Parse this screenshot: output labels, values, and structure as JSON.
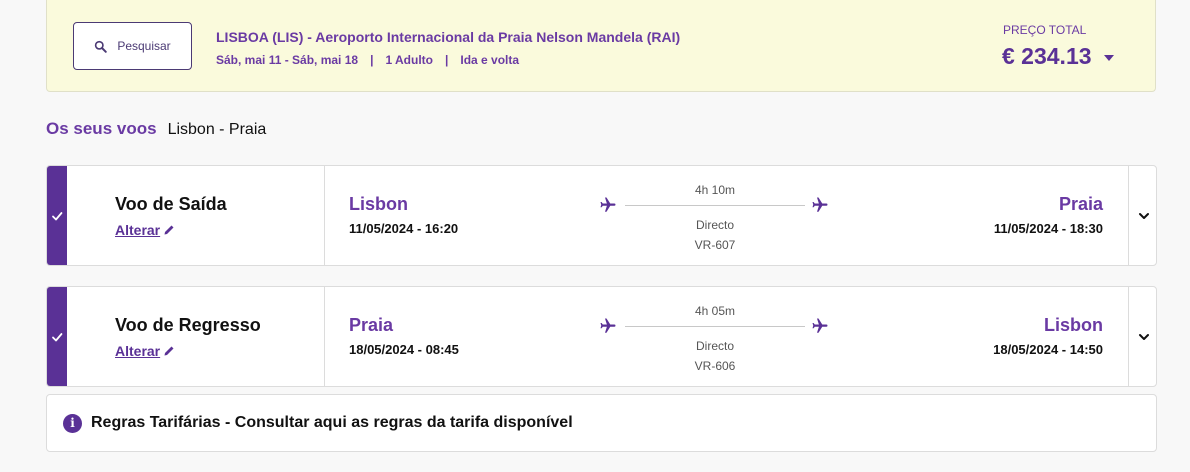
{
  "summary": {
    "search_label": "Pesquisar",
    "route": "LISBOA (LIS) - Aeroporto Internacional da Praia Nelson Mandela (RAI)",
    "dates": "Sáb, mai 11 - Sáb, mai 18",
    "passengers": "1 Adulto",
    "trip_type": "Ida e volta",
    "separator": "|",
    "price_label": "PREÇO TOTAL",
    "price_value": "€ 234.13"
  },
  "section": {
    "label": "Os seus voos",
    "route": "Lisbon - Praia"
  },
  "flights": [
    {
      "leg_title": "Voo de Saída",
      "change_label": "Alterar",
      "origin_city": "Lisbon",
      "origin_datetime": "11/05/2024 - 16:20",
      "duration": "4h 10m",
      "stops": "Directo",
      "flight_number": "VR-607",
      "dest_city": "Praia",
      "dest_datetime": "11/05/2024 - 18:30"
    },
    {
      "leg_title": "Voo de Regresso",
      "change_label": "Alterar",
      "origin_city": "Praia",
      "origin_datetime": "18/05/2024 - 08:45",
      "duration": "4h 05m",
      "stops": "Directo",
      "flight_number": "VR-606",
      "dest_city": "Lisbon",
      "dest_datetime": "18/05/2024 - 14:50"
    }
  ],
  "rules": {
    "info_glyph": "i",
    "text": "Regras Tarifárias - Consultar aqui as regras da tarifa disponível"
  },
  "colors": {
    "accent": "#5a3196",
    "accent_text": "#6a3aa3",
    "summary_bg": "#fafadc"
  },
  "icons": {
    "search": "search-icon",
    "check": "check-icon",
    "edit": "pencil-icon",
    "plane": "airplane-icon",
    "expand": "chevron-down-icon",
    "info": "info-icon"
  }
}
